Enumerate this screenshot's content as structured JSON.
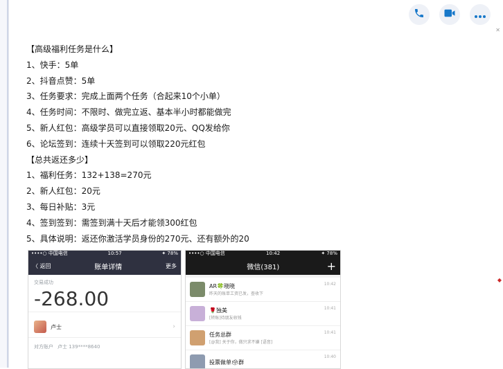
{
  "toolbar": {
    "icons": [
      "phone-icon",
      "video-camera-icon",
      "more-icon"
    ],
    "accent": "#1677c9"
  },
  "message": {
    "lines": [
      "【高级福利任务是什么】",
      "1、快手：5单",
      "2、抖音点赞：5单",
      "3、任务要求：完成上面两个任务（合起来10个小单）",
      "4、任务时间：不限时、做完立返、基本半小时都能做完",
      "5、新人红包：高级学员可以直接领取20元、QQ发给你",
      "6、论坛签到：连续十天签到可以领取220元红包",
      "【总共返还多少】",
      "1、福利任务：132+138=270元",
      "2、新人红包：20元",
      "3、每日补贴：3元",
      "4、签到签到：需签到满十天后才能领300红包",
      "5、具体说明：返还你激活学员身份的270元、还有额外的20"
    ]
  },
  "screenshot_left": {
    "status_carrier": "••••○ 中国电信 ",
    "status_time": "10:57",
    "status_right": "✦ 78%",
    "back_label": "〈 返回",
    "title": "账单详情",
    "more_label": "更多",
    "status_label": "交易成功",
    "amount": "-268.00",
    "payee": "卢士",
    "account_label": "对方账户",
    "account_value": "卢士 139****8640"
  },
  "screenshot_right": {
    "status_carrier": "••••○ 中国电信 ",
    "status_time": "10:42",
    "status_right": "✦ 78%",
    "title": "微信(381)",
    "add_label": "+",
    "chats": [
      {
        "name": "AR🍀晓晓",
        "last": "昨天的账单工资已发，查收下",
        "time": "10:42",
        "color": "#7b8b6a"
      },
      {
        "name": "🌹独美",
        "last": "[转账]待朋友收钱",
        "time": "10:41",
        "color": "#c8b0d8"
      },
      {
        "name": "任务总群",
        "last": "[@我] 关于你，做只求不嫌 [语音]",
        "time": "10:41",
        "color": "#d0a070"
      },
      {
        "name": "投票做单🗳群",
        "last": "",
        "time": "10:40",
        "color": "#8e9bb0"
      }
    ]
  }
}
